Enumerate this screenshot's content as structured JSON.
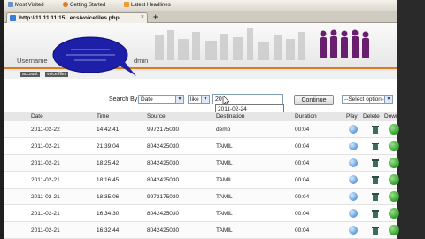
{
  "bookmarks": [
    {
      "label": "Most Visited"
    },
    {
      "label": "Getting Started"
    },
    {
      "label": "Latest Headlines"
    }
  ],
  "tab": {
    "title": "http://11.11.11.15...ecs/voicefiles.php"
  },
  "header": {
    "username_label": "Username",
    "admin_label": "dmin"
  },
  "nav": {
    "items": [
      "account",
      "voice files"
    ]
  },
  "toolbar": {
    "search_by_label": "Search By:",
    "field_select": "Date",
    "operator_select": "like",
    "search_value": "20",
    "autocomplete_suggestion": "2011-02-24",
    "continue_label": "Continue",
    "action_select": "--Select option--"
  },
  "table": {
    "headers": [
      "Date",
      "Time",
      "Source",
      "Destination",
      "Duration",
      "Play",
      "Delete",
      "Down"
    ],
    "rows": [
      {
        "date": "2011-02-22",
        "time": "14:42:41",
        "source": "9972175030",
        "destination": "demo",
        "duration": "00:04"
      },
      {
        "date": "2011-02-21",
        "time": "21:39:04",
        "source": "8042425030",
        "destination": "TAMIL",
        "duration": "00:04"
      },
      {
        "date": "2011-02-21",
        "time": "18:25:42",
        "source": "8042425030",
        "destination": "TAMIL",
        "duration": "00:04"
      },
      {
        "date": "2011-02-21",
        "time": "18:16:45",
        "source": "8042425030",
        "destination": "TAMIL",
        "duration": "00:04"
      },
      {
        "date": "2011-02-21",
        "time": "18:35:06",
        "source": "9972175030",
        "destination": "TAMIL",
        "duration": "00:04"
      },
      {
        "date": "2011-02-21",
        "time": "16:34:30",
        "source": "8042425030",
        "destination": "TAMIL",
        "duration": "00:04"
      },
      {
        "date": "2011-02-21",
        "time": "16:32:44",
        "source": "8042425030",
        "destination": "TAMIL",
        "duration": "00:04"
      }
    ]
  },
  "colors": {
    "accent": "#e07a1f",
    "balloon": "#1d1fa8",
    "people": "#6a1f6e",
    "play": "#5d9ad8",
    "download": "#2f9a2a"
  }
}
